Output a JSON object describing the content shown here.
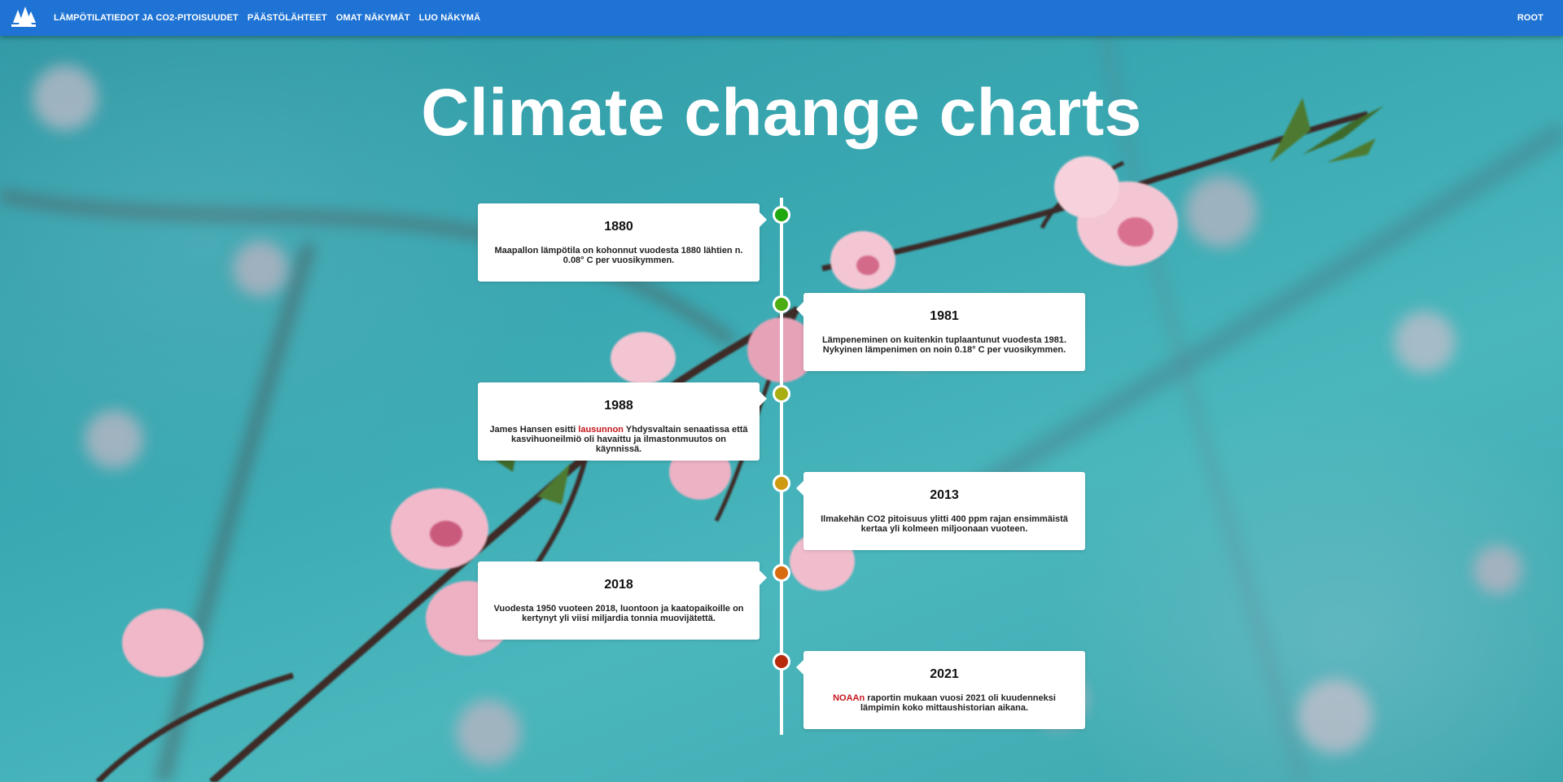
{
  "nav": {
    "logo_icon": "trees-icon",
    "links": [
      "Lämpötilatiedot ja CO2-pitoisuudet",
      "Päästölähteet",
      "Omat näkymät",
      "Luo näkymä"
    ],
    "user": "Root"
  },
  "page_title": "Climate change charts",
  "timeline": [
    {
      "year": "1880",
      "text": "Maapallon lämpötila on kohonnut vuodesta 1880 lähtien n. 0.08° C per vuosikymmen.",
      "dot_color": "#1fa80f"
    },
    {
      "year": "1981",
      "text": "Lämpeneminen on kuitenkin tuplaantunut vuodesta 1981. Nykyinen lämpenimen on noin 0.18° C per vuosikymmen.",
      "dot_color": "#4cad12"
    },
    {
      "year": "1988",
      "text_before": "James Hansen esitti ",
      "link": "lausunnon",
      "text_after": " Yhdysvaltain senaatissa että kasvihuoneilmiö oli havaittu ja ilmastonmuutos on käynnissä.",
      "dot_color": "#a8ad12"
    },
    {
      "year": "2013",
      "text": "Ilmakehän CO2 pitoisuus ylitti 400 ppm rajan ensimmäistä kertaa yli kolmeen miljoonaan vuoteen.",
      "dot_color": "#cf9a12"
    },
    {
      "year": "2018",
      "text": "Vuodesta 1950 vuoteen 2018, luontoon ja kaatopaikoille on kertynyt yli viisi miljardia tonnia muovijätettä.",
      "dot_color": "#d86b0e"
    },
    {
      "year": "2021",
      "link": "NOAAn",
      "text_after": " raportin mukaan vuosi 2021 oli kuudenneksi lämpimin koko mittaushistorian aikana.",
      "dot_color": "#b82a0c"
    }
  ]
}
